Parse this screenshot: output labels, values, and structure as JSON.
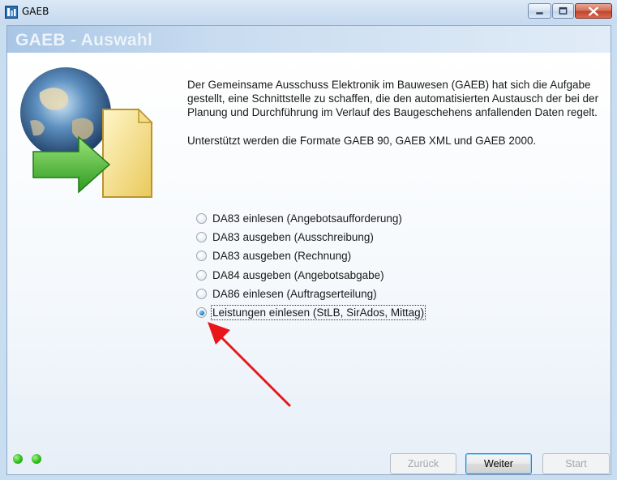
{
  "window": {
    "title": "GAEB",
    "app_icon": "gaeb-app-icon",
    "controls": [
      "minimize-icon",
      "maximize-icon",
      "close-icon"
    ]
  },
  "header": {
    "title": "GAEB  - Auswahl"
  },
  "illustration": {
    "icon": "globe-document-import-icon"
  },
  "description": {
    "paragraph1": "Der Gemeinsame Ausschuss Elektronik im Bauwesen (GAEB) hat sich die Aufgabe gestellt, eine Schnittstelle zu schaffen, die den automatisierten Austausch der bei der Planung und Durchführung im Verlauf des Baugeschehens anfallenden Daten regelt.",
    "paragraph2": "Unterstützt werden die Formate GAEB 90, GAEB XML und GAEB 2000."
  },
  "options": [
    {
      "label": "DA83 einlesen (Angebotsaufforderung)",
      "checked": false
    },
    {
      "label": "DA83 ausgeben (Ausschreibung)",
      "checked": false
    },
    {
      "label": "DA83 ausgeben (Rechnung)",
      "checked": false
    },
    {
      "label": "DA84 ausgeben (Angebotsabgabe)",
      "checked": false
    },
    {
      "label": "DA86 einlesen (Auftragserteilung)",
      "checked": false
    },
    {
      "label": "Leistungen einlesen (StLB, SirAdos, Mittag)",
      "checked": true
    }
  ],
  "annotation": {
    "icon": "red-arrow-icon",
    "color": "#e8161b"
  },
  "status": {
    "indicators": [
      "green-dot-icon",
      "green-dot-icon"
    ],
    "color": "#2fbf1e"
  },
  "buttons": {
    "back": "Zurück",
    "next": "Weiter",
    "start": "Start"
  }
}
